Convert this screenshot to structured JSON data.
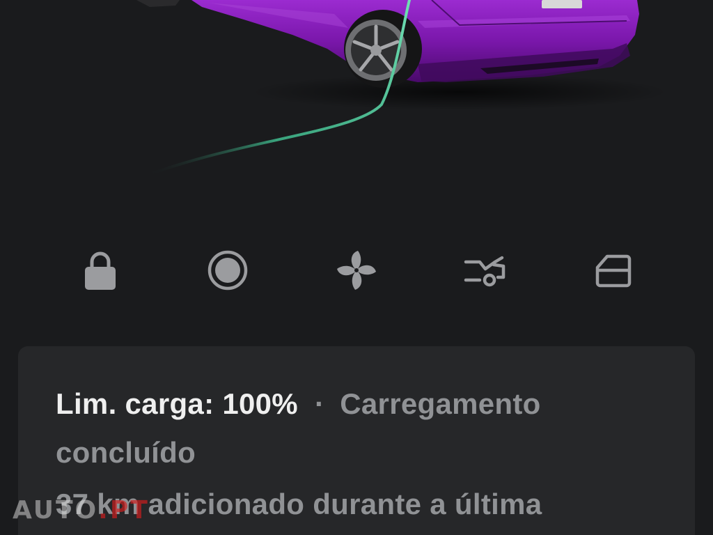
{
  "colors": {
    "background": "#1a1b1d",
    "card": "#262729",
    "icon": "#9b9c9f",
    "car_body": "#7a1aa8",
    "cable": "#5fd6a7",
    "text_primary": "#efefef",
    "text_secondary": "#909295"
  },
  "vehicle": {
    "image": "purple-car-rear-charging"
  },
  "controls": [
    {
      "name": "lock",
      "icon": "lock-icon"
    },
    {
      "name": "climate",
      "icon": "record-circle-icon"
    },
    {
      "name": "fan",
      "icon": "fan-icon"
    },
    {
      "name": "trunk",
      "icon": "trunk-open-icon"
    },
    {
      "name": "frunk",
      "icon": "frunk-icon"
    }
  ],
  "charging": {
    "limit_label": "Lim. carga: 100%",
    "separator": "·",
    "status": "Carregamento concluído",
    "added": "37 km adicionado durante a última"
  },
  "watermark": {
    "text_a": "AUTO",
    "text_b": ".PT"
  }
}
